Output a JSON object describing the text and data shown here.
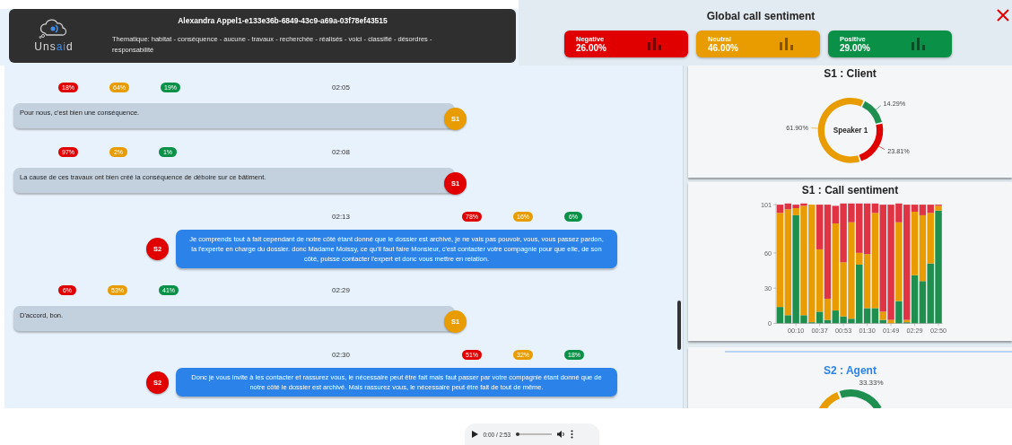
{
  "header": {
    "logo_parts": [
      {
        "text": "Uns",
        "accent": false
      },
      {
        "text": "ai",
        "accent": true
      },
      {
        "text": "d",
        "accent": false
      }
    ],
    "title": "Alexandra Appel1-e133e36b-6849-43c9-a69a-03f78ef43515",
    "thematique": "Thematique: habitat - conséquence - aucune - travaux - recherchée - réalisés - voici - classifié - désordres - responsabilité"
  },
  "global_sentiment": {
    "title": "Global call sentiment",
    "cards": [
      {
        "kind": "negative",
        "label": "Negative",
        "value": "26.00%"
      },
      {
        "kind": "neutral",
        "label": "Neutral",
        "value": "46.00%"
      },
      {
        "kind": "positive",
        "label": "Positive",
        "value": "29.00%"
      }
    ]
  },
  "messages": [
    {
      "kind": "client",
      "speaker": "S1",
      "color": "#e89c00",
      "time": "02:05",
      "scores": [
        {
          "kind": "negative",
          "value": "18%"
        },
        {
          "kind": "neutral",
          "value": "64%"
        },
        {
          "kind": "positive",
          "value": "19%"
        }
      ],
      "text": "Pour nous, c'est bien une conséquence."
    },
    {
      "kind": "client",
      "speaker": "S1",
      "color": "#e00000",
      "time": "02:08",
      "scores": [
        {
          "kind": "negative",
          "value": "97%"
        },
        {
          "kind": "neutral",
          "value": "2%"
        },
        {
          "kind": "positive",
          "value": "1%"
        }
      ],
      "text": "La cause de ces travaux ont bien créé la conséquence de déboire sur ce bâtiment."
    },
    {
      "kind": "agent",
      "speaker": "S2",
      "color": "#e00000",
      "time": "02:13",
      "scores": [
        {
          "kind": "negative",
          "value": "78%"
        },
        {
          "kind": "neutral",
          "value": "16%"
        },
        {
          "kind": "positive",
          "value": "6%"
        }
      ],
      "text": "Je comprends tout à fait cependant de notre côté étant donné que le dossier est archivé, je ne vais pas pouvoir, vous, vous passez pardon, la l'experte en charge du dossier. donc Madame Moissy, ce qu'il faut faire Monsieur, c'est contacter votre compagnie pour que elle, de son côté, puisse contacter l'expert et donc vous mettre en relation."
    },
    {
      "kind": "client",
      "speaker": "S1",
      "color": "#e89c00",
      "time": "02:29",
      "scores": [
        {
          "kind": "negative",
          "value": "6%"
        },
        {
          "kind": "neutral",
          "value": "53%"
        },
        {
          "kind": "positive",
          "value": "41%"
        }
      ],
      "text": "D'accord, bon."
    },
    {
      "kind": "agent",
      "speaker": "S2",
      "color": "#e00000",
      "time": "02:30",
      "scores": [
        {
          "kind": "negative",
          "value": "51%"
        },
        {
          "kind": "neutral",
          "value": "32%"
        },
        {
          "kind": "positive",
          "value": "18%"
        }
      ],
      "text": "Donc je vous invite à les contacter et rassurez vous, le nécessaire peut être fait mais faut passer par votre compagnie étant donné que de notre côté le dossier est archivé. Mais rassurez vous, le nécessaire peut être fait de tout de même."
    }
  ],
  "s1_client": {
    "title": "S1 : Client",
    "center_label": "Speaker 1",
    "chart_data": {
      "type": "donut",
      "values": [
        14.29,
        23.81,
        61.9
      ],
      "colors": [
        "#1e8f4e",
        "#e00000",
        "#e89c00"
      ],
      "value_labels": [
        "14.29%",
        "23.81%",
        "61.90%"
      ]
    }
  },
  "s1_call_sentiment": {
    "title": "S1 : Call sentiment",
    "chart_data": {
      "type": "bar",
      "stacked": true,
      "categories": [
        null,
        null,
        "00:10",
        null,
        null,
        "00:37",
        null,
        null,
        "00:53",
        null,
        null,
        "01:30",
        null,
        null,
        "01:49",
        null,
        null,
        "02:29",
        null,
        null,
        "02:50"
      ],
      "ylim": [
        0,
        102
      ],
      "yticks": [
        0,
        30,
        60,
        101
      ],
      "series": [
        {
          "color": "#1e8f4e",
          "values": [
            14,
            7,
            92,
            7,
            1,
            10,
            3,
            11,
            6,
            4,
            50,
            13,
            13,
            3,
            0,
            19,
            1,
            41,
            36,
            51,
            96
          ]
        },
        {
          "color": "#e89c00",
          "values": [
            80,
            90,
            6,
            93,
            100,
            53,
            18,
            74,
            46,
            82,
            10,
            46,
            81,
            7,
            3,
            67,
            2,
            54,
            56,
            43,
            4
          ]
        },
        {
          "color": "#e03444",
          "values": [
            7,
            5,
            3,
            2,
            0,
            38,
            80,
            15,
            50,
            16,
            42,
            43,
            8,
            91,
            98,
            16,
            98,
            6,
            9,
            7,
            1
          ]
        }
      ]
    }
  },
  "s2_agent": {
    "title": "S2 : Agent",
    "label": "33.33%"
  },
  "player": {
    "time": "0:00 / 2:53",
    "level": 0
  }
}
